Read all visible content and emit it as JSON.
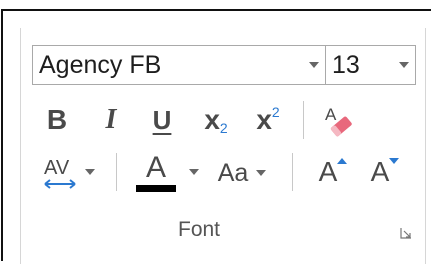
{
  "font_group": {
    "font_name": "Agency FB",
    "font_size": "13",
    "group_label": "Font"
  },
  "row1": {
    "bold_label": "B",
    "italic_label": "I",
    "underline_label": "U",
    "subscript_base": "x",
    "subscript_mark": "2",
    "superscript_base": "x",
    "superscript_mark": "2"
  },
  "row2": {
    "spacing_label": "AV",
    "font_color_label": "A",
    "change_case_label": "Aa",
    "grow_font_label": "A",
    "shrink_font_label": "A"
  },
  "colors": {
    "font_color_swatch": "#000000",
    "accent_blue": "#2b79d0",
    "eraser_pink": "#e8687c",
    "icon_gray": "#4a4a4a"
  }
}
